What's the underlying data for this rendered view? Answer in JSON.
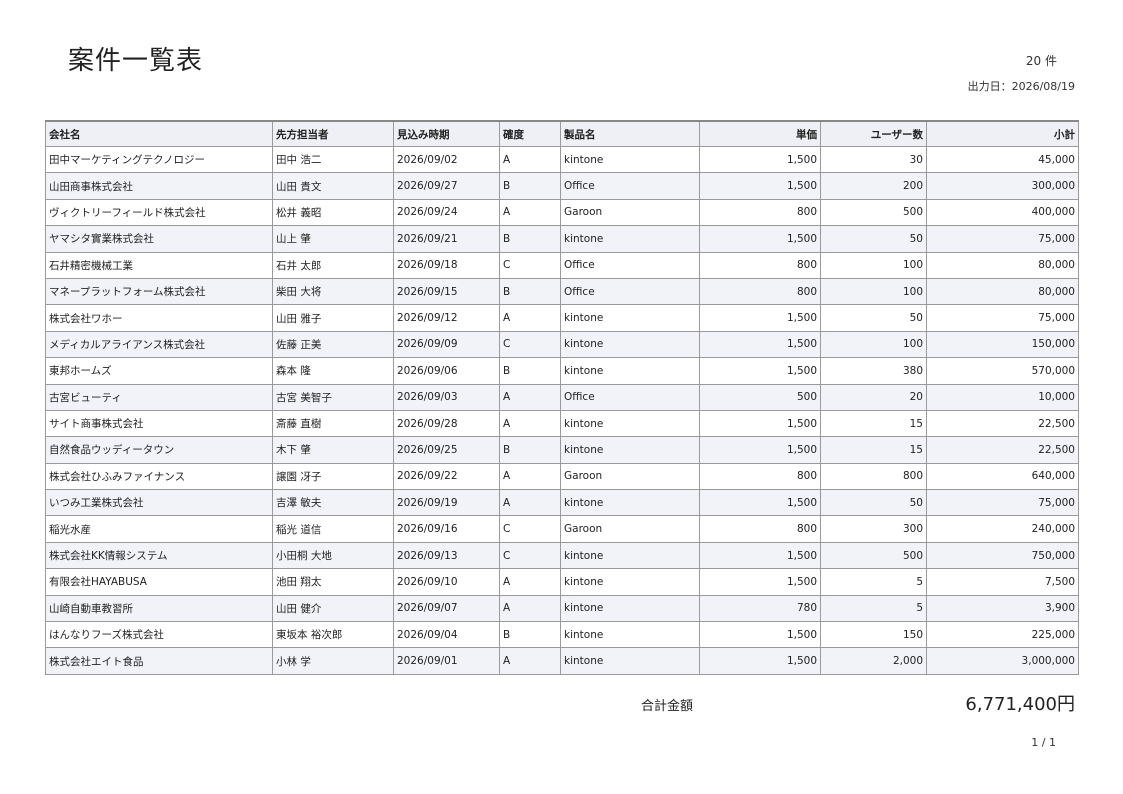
{
  "title": "案件一覧表",
  "count": "20 件",
  "output_date": "出力日：2026/08/19",
  "columns": [
    "会社名",
    "先方担当者",
    "見込み時期",
    "確度",
    "製品名",
    "単価",
    "ユーザー数",
    "小計"
  ],
  "rows": [
    [
      "田中マーケティングテクノロジー",
      "田中 浩二",
      "2026/09/02",
      "A",
      "kintone",
      "1,500",
      "30",
      "45,000"
    ],
    [
      "山田商事株式会社",
      "山田 貴文",
      "2026/09/27",
      "B",
      "Office",
      "1,500",
      "200",
      "300,000"
    ],
    [
      "ヴィクトリーフィールド株式会社",
      "松井 義昭",
      "2026/09/24",
      "A",
      "Garoon",
      "800",
      "500",
      "400,000"
    ],
    [
      "ヤマシタ實業株式会社",
      "山上 肇",
      "2026/09/21",
      "B",
      "kintone",
      "1,500",
      "50",
      "75,000"
    ],
    [
      "石井精密機械工業",
      "石井 太郎",
      "2026/09/18",
      "C",
      "Office",
      "800",
      "100",
      "80,000"
    ],
    [
      "マネープラットフォーム株式会社",
      "柴田 大将",
      "2026/09/15",
      "B",
      "Office",
      "800",
      "100",
      "80,000"
    ],
    [
      "株式会社ワホー",
      "山田 雅子",
      "2026/09/12",
      "A",
      "kintone",
      "1,500",
      "50",
      "75,000"
    ],
    [
      "メディカルアライアンス株式会社",
      "佐藤 正美",
      "2026/09/09",
      "C",
      "kintone",
      "1,500",
      "100",
      "150,000"
    ],
    [
      "東邦ホームズ",
      "森本 隆",
      "2026/09/06",
      "B",
      "kintone",
      "1,500",
      "380",
      "570,000"
    ],
    [
      "古宮ビューティ",
      "古宮 美智子",
      "2026/09/03",
      "A",
      "Office",
      "500",
      "20",
      "10,000"
    ],
    [
      "サイト商事株式会社",
      "斎藤 直樹",
      "2026/09/28",
      "A",
      "kintone",
      "1,500",
      "15",
      "22,500"
    ],
    [
      "自然食品ウッディータウン",
      "木下 肇",
      "2026/09/25",
      "B",
      "kintone",
      "1,500",
      "15",
      "22,500"
    ],
    [
      "株式会社ひふみファイナンス",
      "譲園 冴子",
      "2026/09/22",
      "A",
      "Garoon",
      "800",
      "800",
      "640,000"
    ],
    [
      "いつみ工業株式会社",
      "吉澤 敏夫",
      "2026/09/19",
      "A",
      "kintone",
      "1,500",
      "50",
      "75,000"
    ],
    [
      "稲光水産",
      "稲光 道信",
      "2026/09/16",
      "C",
      "Garoon",
      "800",
      "300",
      "240,000"
    ],
    [
      "株式会社KK情報システム",
      "小田桐 大地",
      "2026/09/13",
      "C",
      "kintone",
      "1,500",
      "500",
      "750,000"
    ],
    [
      "有限会社HAYABUSA",
      "池田 翔太",
      "2026/09/10",
      "A",
      "kintone",
      "1,500",
      "5",
      "7,500"
    ],
    [
      "山崎自動車教習所",
      "山田 健介",
      "2026/09/07",
      "A",
      "kintone",
      "780",
      "5",
      "3,900"
    ],
    [
      "はんなりフーズ株式会社",
      "東坂本 裕次郎",
      "2026/09/04",
      "B",
      "kintone",
      "1,500",
      "150",
      "225,000"
    ],
    [
      "株式会社エイト食品",
      "小林 学",
      "2026/09/01",
      "A",
      "kintone",
      "1,500",
      "2,000",
      "3,000,000"
    ]
  ],
  "total_label": "合計金額",
  "total_value": "6,771,400円",
  "page": "1 / 1"
}
